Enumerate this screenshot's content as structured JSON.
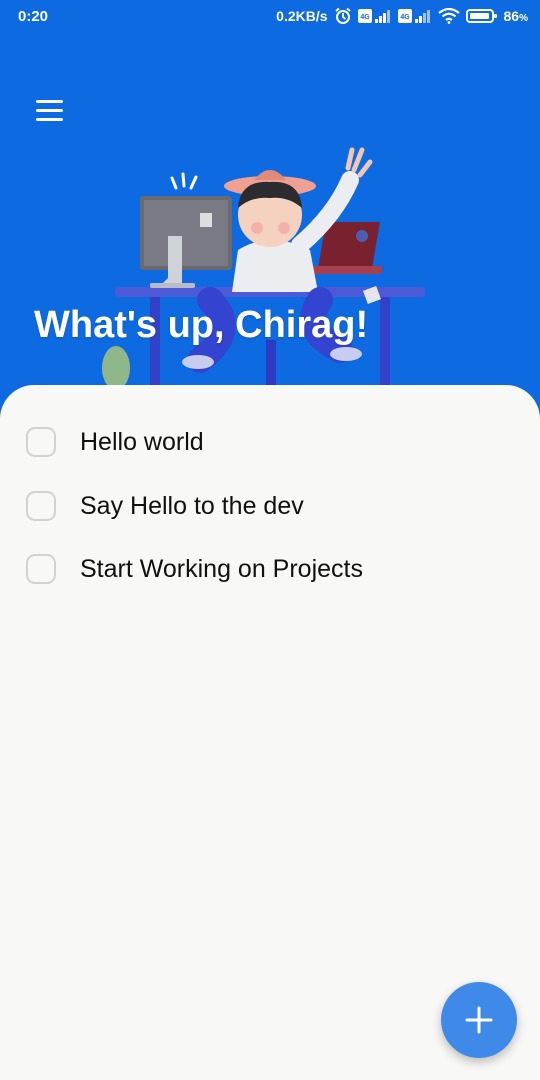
{
  "status_bar": {
    "time": "0:20",
    "network_speed": "0.2KB/s",
    "battery": "86",
    "battery_unit": "%",
    "icons": [
      "alarm-icon",
      "volte-signal-icon",
      "volte-signal-icon",
      "wifi-icon",
      "battery-icon"
    ]
  },
  "header": {
    "menu_icon": "hamburger-menu-icon",
    "greeting": "What's up, Chirag!",
    "background_color": "#0d6ae0"
  },
  "tasks": [
    {
      "label": "Hello world",
      "checked": false
    },
    {
      "label": "Say Hello to the dev",
      "checked": false
    },
    {
      "label": "Start Working on Projects",
      "checked": false
    }
  ],
  "fab": {
    "icon": "plus-icon",
    "color": "#3f8ae9"
  }
}
